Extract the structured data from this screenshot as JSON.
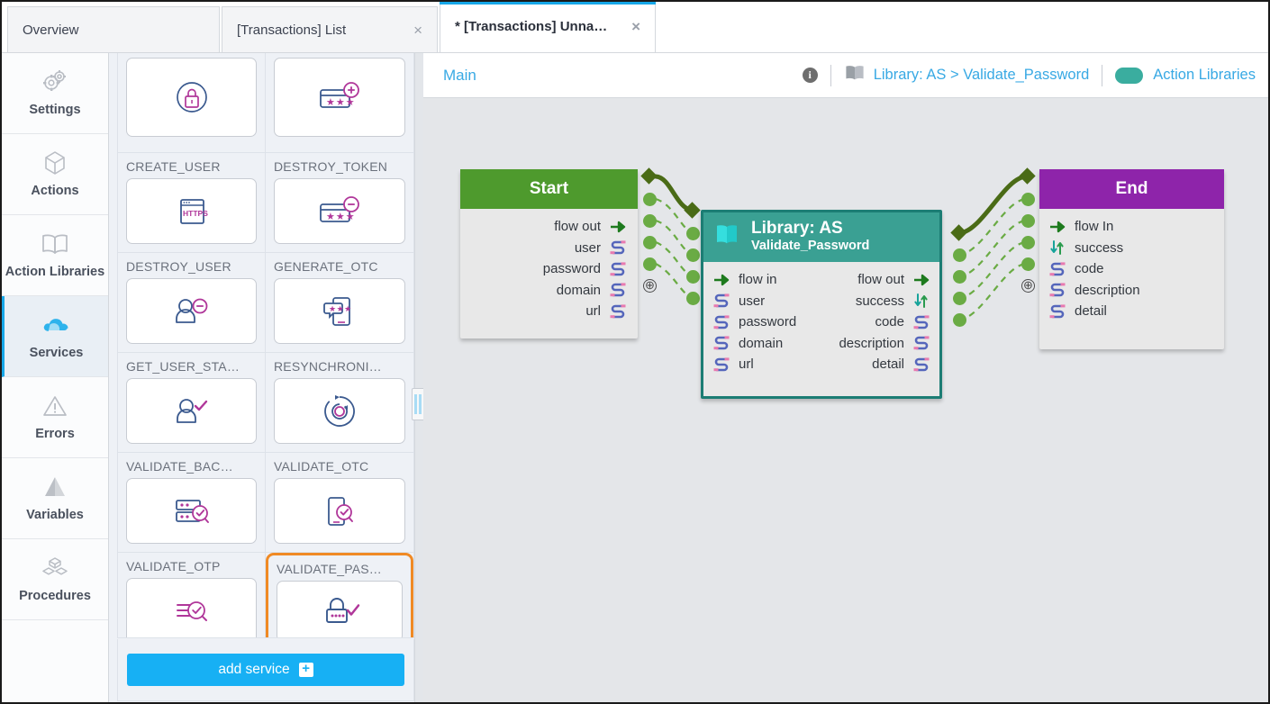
{
  "tabs": [
    {
      "label": "Overview",
      "active": false,
      "closable": false,
      "modified": false
    },
    {
      "label": "[Transactions] List",
      "active": false,
      "closable": true,
      "modified": false
    },
    {
      "label": "* [Transactions] Unna…",
      "active": true,
      "closable": true,
      "modified": true
    }
  ],
  "close_glyph": "×",
  "rail": {
    "items": [
      {
        "label": "Settings",
        "icon": "gears-icon",
        "active": false
      },
      {
        "label": "Actions",
        "icon": "cube-icon",
        "active": false
      },
      {
        "label": "Action Libraries",
        "icon": "book-icon",
        "active": false
      },
      {
        "label": "Services",
        "icon": "cloud-icon",
        "active": true
      },
      {
        "label": "Errors",
        "icon": "warning-triangle-icon",
        "active": false
      },
      {
        "label": "Variables",
        "icon": "pyramid-icon",
        "active": false
      },
      {
        "label": "Procedures",
        "icon": "blocks-icon",
        "active": false
      }
    ]
  },
  "services": {
    "tiles": [
      {
        "title": "",
        "icon": "lock-circle-icon",
        "clipped": true,
        "selected": false
      },
      {
        "title": "",
        "icon": "card-password-plus-icon",
        "clipped": true,
        "selected": false
      },
      {
        "title": "CREATE_USER",
        "icon": "https-browser-icon",
        "clipped": false,
        "selected": false
      },
      {
        "title": "DESTROY_TOKEN",
        "icon": "card-password-minus-icon",
        "clipped": false,
        "selected": false
      },
      {
        "title": "DESTROY_USER",
        "icon": "user-minus-icon",
        "clipped": false,
        "selected": false
      },
      {
        "title": "GENERATE_OTC",
        "icon": "phone-otc-icon",
        "clipped": false,
        "selected": false
      },
      {
        "title": "GET_USER_STA…",
        "icon": "user-check-icon",
        "clipped": false,
        "selected": false
      },
      {
        "title": "RESYNCHRONI…",
        "icon": "resync-icon",
        "clipped": false,
        "selected": false
      },
      {
        "title": "VALIDATE_BAC…",
        "icon": "server-check-icon",
        "clipped": false,
        "selected": false
      },
      {
        "title": "VALIDATE_OTC",
        "icon": "phone-check-icon",
        "clipped": false,
        "selected": false
      },
      {
        "title": "VALIDATE_OTP",
        "icon": "list-search-icon",
        "clipped": false,
        "selected": false
      },
      {
        "title": "VALIDATE_PAS…",
        "icon": "lock-check-icon",
        "clipped": false,
        "selected": true
      }
    ],
    "add_button_label": "add service",
    "add_button_glyph": "+"
  },
  "canvas_header": {
    "breadcrumb_main": "Main",
    "info_glyph": "i",
    "library_crumb": "Library: AS > Validate_Password",
    "action_libraries_label": "Action Libraries"
  },
  "flow": {
    "start_node": {
      "title": "Start",
      "ports_out": [
        {
          "label": "flow out",
          "icon": "flow-arrow-icon"
        },
        {
          "label": "user",
          "icon": "data-cable-icon"
        },
        {
          "label": "password",
          "icon": "data-cable-icon"
        },
        {
          "label": "domain",
          "icon": "data-cable-icon"
        },
        {
          "label": "url",
          "icon": "data-cable-icon"
        }
      ]
    },
    "library_node": {
      "title": "Library: AS",
      "subtitle": "Validate_Password",
      "ports_in": [
        {
          "label": "flow in",
          "icon": "flow-arrow-icon"
        },
        {
          "label": "user",
          "icon": "data-cable-icon"
        },
        {
          "label": "password",
          "icon": "data-cable-icon"
        },
        {
          "label": "domain",
          "icon": "data-cable-icon"
        },
        {
          "label": "url",
          "icon": "data-cable-icon"
        }
      ],
      "ports_out": [
        {
          "label": "flow out",
          "icon": "flow-arrow-icon"
        },
        {
          "label": "success",
          "icon": "updown-arrows-icon"
        },
        {
          "label": "code",
          "icon": "data-cable-icon"
        },
        {
          "label": "description",
          "icon": "data-cable-icon"
        },
        {
          "label": "detail",
          "icon": "data-cable-icon"
        }
      ]
    },
    "end_node": {
      "title": "End",
      "ports_in": [
        {
          "label": "flow In",
          "icon": "flow-arrow-icon"
        },
        {
          "label": "success",
          "icon": "updown-arrows-icon"
        },
        {
          "label": "code",
          "icon": "data-cable-icon"
        },
        {
          "label": "description",
          "icon": "data-cable-icon"
        },
        {
          "label": "detail",
          "icon": "data-cable-icon"
        }
      ]
    },
    "add_port_glyph": "⊕"
  },
  "colors": {
    "accent_blue": "#17a7e8",
    "link_blue": "#38a9e4",
    "start_green": "#4e9a2d",
    "end_purple": "#8e24aa",
    "library_teal": "#3aa093",
    "library_border": "#1c7d74",
    "selection_orange": "#f08a24",
    "edge_green": "#6aab44",
    "flow_edge_olive": "#4a6b16"
  }
}
